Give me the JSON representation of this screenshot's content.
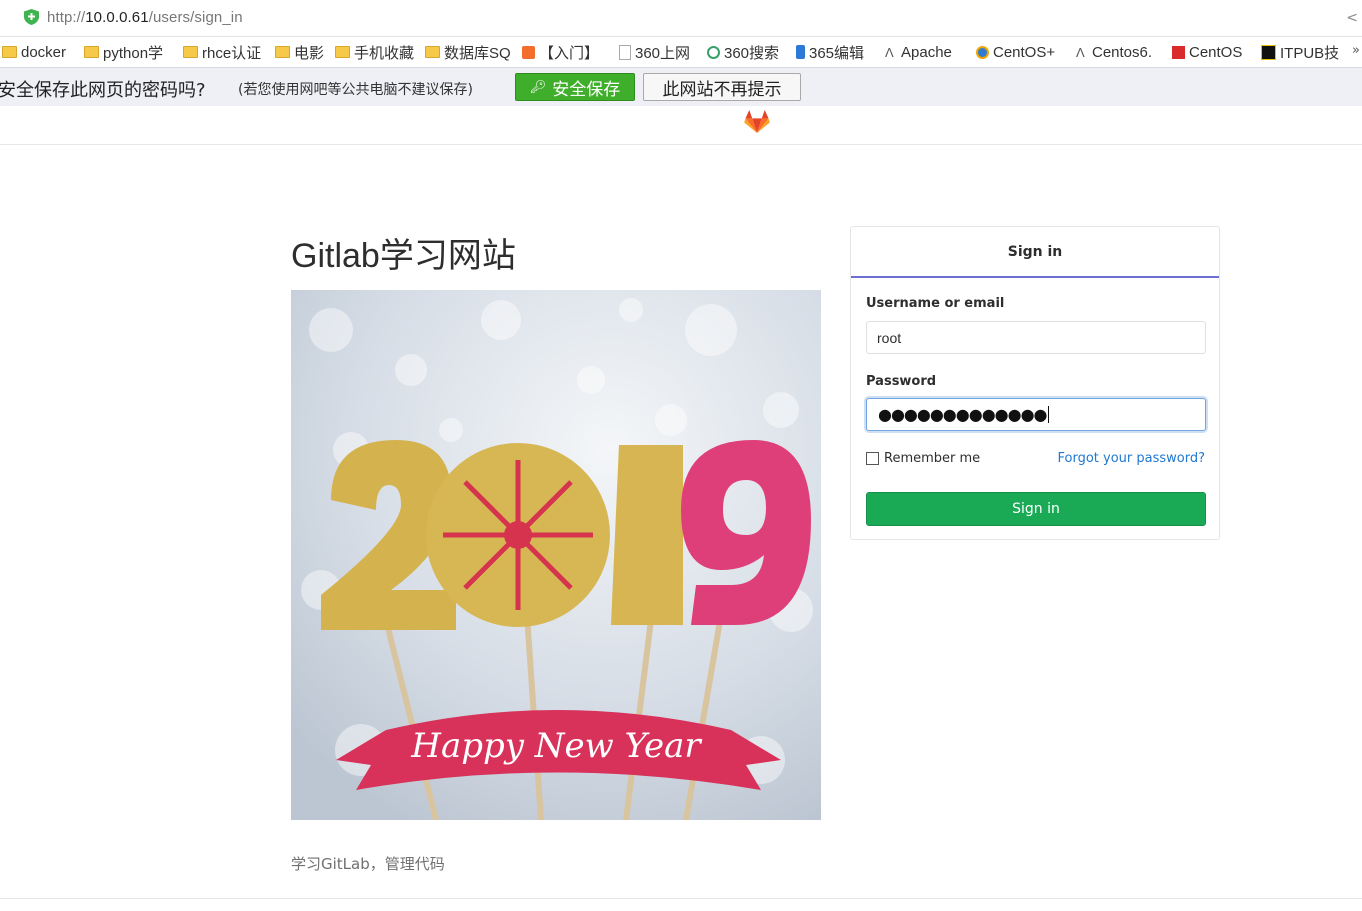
{
  "browser": {
    "url_scheme": "http://",
    "url_host": "10.0.0.61",
    "url_path": "/users/sign_in",
    "bookmarks": [
      {
        "label": "docker",
        "icon": "folder-icon"
      },
      {
        "label": "python学",
        "icon": "folder-icon"
      },
      {
        "label": "rhce认证",
        "icon": "folder-icon"
      },
      {
        "label": "电影",
        "icon": "folder-icon"
      },
      {
        "label": "手机收藏",
        "icon": "folder-icon"
      },
      {
        "label": "数据库SQ",
        "icon": "folder-icon"
      },
      {
        "label": "【入门】",
        "icon": "site-icon"
      },
      {
        "label": "360上网",
        "icon": "page-icon"
      },
      {
        "label": "360搜索",
        "icon": "search-site-icon"
      },
      {
        "label": "365编辑",
        "icon": "site-icon"
      },
      {
        "label": "Apache",
        "icon": "apache-icon"
      },
      {
        "label": "CentOS+",
        "icon": "centos-icon"
      },
      {
        "label": "Centos6.",
        "icon": "apache-icon"
      },
      {
        "label": "CentOS",
        "icon": "site-icon"
      },
      {
        "label": "ITPUB技",
        "icon": "itpub-icon"
      }
    ],
    "more": "»"
  },
  "password_bar": {
    "question": "安全保存此网页的密码吗?",
    "note": "(若您使用网吧等公共电脑不建议保存)",
    "save_label": "安全保存",
    "never_label": "此网站不再提示"
  },
  "brand": {
    "title": "Gitlab学习网站",
    "image_text": "Happy New Year",
    "image_year": "2019",
    "description": "学习GitLab，管理代码"
  },
  "login": {
    "tab_label": "Sign in",
    "username_label": "Username or email",
    "username_value": "root",
    "password_label": "Password",
    "password_mask": "●●●●●●●●●●●●●",
    "remember_label": "Remember me",
    "forgot_label": "Forgot your password?",
    "submit_label": "Sign in"
  },
  "colors": {
    "signin_green": "#1aaa55",
    "tab_underline": "#6b6fcf",
    "link_blue": "#1f78d1",
    "save_green": "#3fae2a"
  }
}
